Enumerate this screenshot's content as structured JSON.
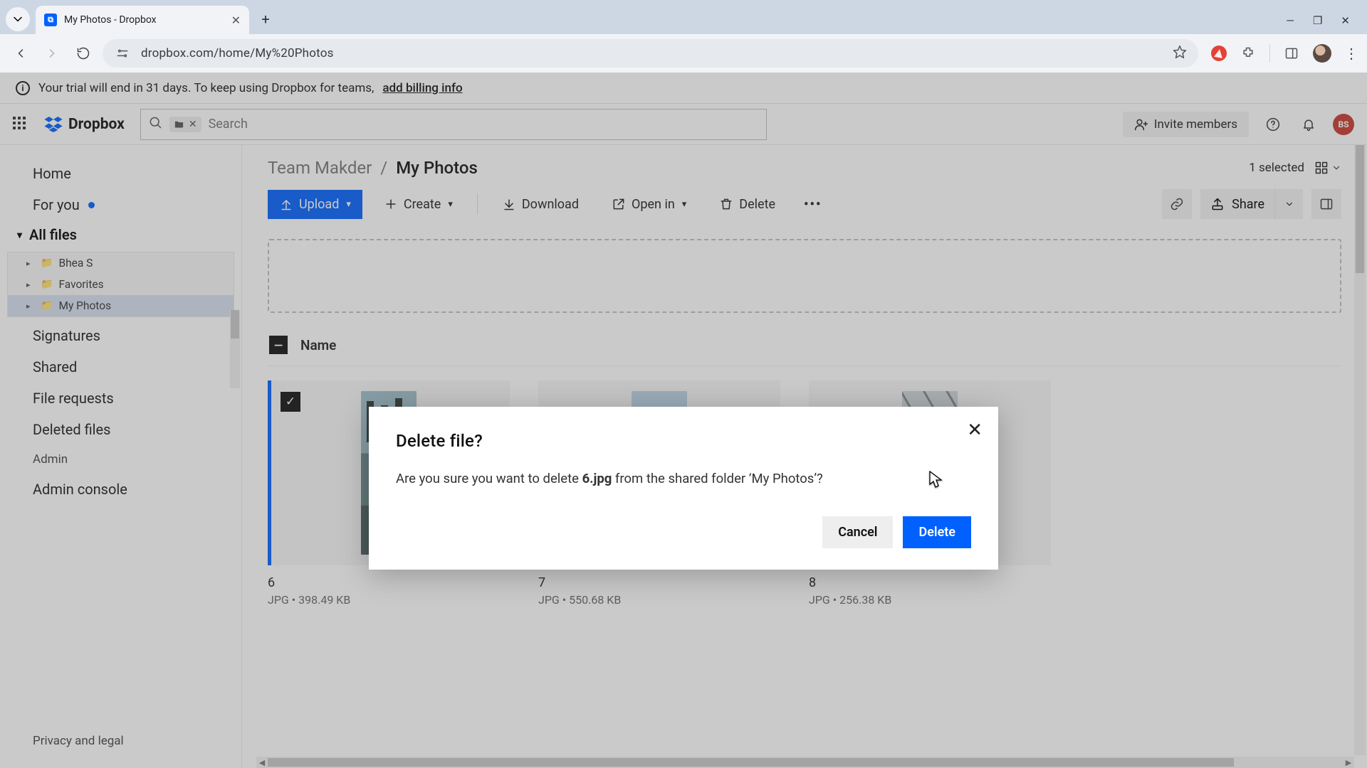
{
  "browser": {
    "tab_title": "My Photos - Dropbox",
    "url": "dropbox.com/home/My%20Photos"
  },
  "trial_banner": {
    "text": "Your trial will end in 31 days. To keep using Dropbox for teams,",
    "link": "add billing info"
  },
  "header": {
    "brand": "Dropbox",
    "search_placeholder": "Search",
    "invite_label": "Invite members",
    "avatar_initials": "BS"
  },
  "sidebar": {
    "home": "Home",
    "for_you": "For you",
    "all_files": "All files",
    "tree": [
      {
        "label": "Bhea S"
      },
      {
        "label": "Favorites"
      },
      {
        "label": "My Photos"
      }
    ],
    "signatures": "Signatures",
    "shared": "Shared",
    "file_requests": "File requests",
    "deleted": "Deleted files",
    "admin": "Admin",
    "admin_console": "Admin console",
    "privacy": "Privacy and legal"
  },
  "breadcrumb": {
    "root": "Team Makder",
    "current": "My Photos",
    "selected_text": "1 selected"
  },
  "actions": {
    "upload": "Upload",
    "create": "Create",
    "download": "Download",
    "open_in": "Open in",
    "delete": "Delete",
    "share": "Share"
  },
  "list_header": {
    "name": "Name"
  },
  "files": [
    {
      "name": "6",
      "meta": "JPG • 398.49 KB"
    },
    {
      "name": "7",
      "meta": "JPG • 550.68 KB"
    },
    {
      "name": "8",
      "meta": "JPG • 256.38 KB"
    }
  ],
  "modal": {
    "title": "Delete file?",
    "msg_pre": "Are you sure you want to delete ",
    "filename": "6.jpg",
    "msg_post": " from the shared folder ‘My Photos’?",
    "cancel": "Cancel",
    "delete": "Delete"
  }
}
